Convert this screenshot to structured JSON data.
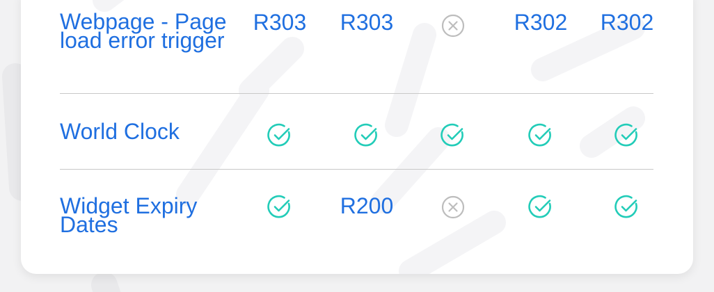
{
  "rows": [
    {
      "feature": "Webpage - Page load error trigger",
      "cells": [
        {
          "type": "text",
          "value": "R303"
        },
        {
          "type": "text",
          "value": "R303"
        },
        {
          "type": "icon",
          "icon": "x-circle-icon"
        },
        {
          "type": "text",
          "value": "R302"
        },
        {
          "type": "text",
          "value": "R302"
        }
      ]
    },
    {
      "feature": "World Clock",
      "cells": [
        {
          "type": "icon",
          "icon": "check-circle-icon"
        },
        {
          "type": "icon",
          "icon": "check-circle-icon"
        },
        {
          "type": "icon",
          "icon": "check-circle-icon"
        },
        {
          "type": "icon",
          "icon": "check-circle-icon"
        },
        {
          "type": "icon",
          "icon": "check-circle-icon"
        }
      ]
    },
    {
      "feature": "Widget Expiry Dates",
      "cells": [
        {
          "type": "icon",
          "icon": "check-circle-icon"
        },
        {
          "type": "text",
          "value": "R200"
        },
        {
          "type": "icon",
          "icon": "x-circle-icon"
        },
        {
          "type": "icon",
          "icon": "check-circle-icon"
        },
        {
          "type": "icon",
          "icon": "check-circle-icon"
        }
      ]
    }
  ],
  "colors": {
    "text": "#1f6fe0",
    "check": "#22ccb8",
    "cross": "#bdbdbd",
    "divider": "#c8c8c8"
  }
}
